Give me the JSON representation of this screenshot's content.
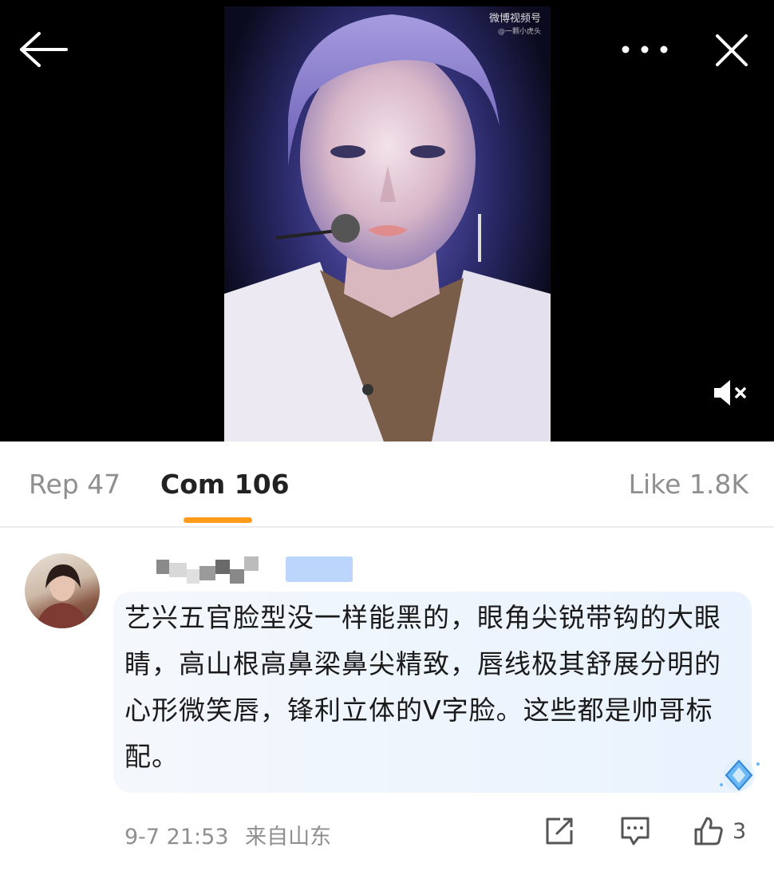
{
  "video": {
    "watermark_title": "微博视频号",
    "watermark_sub": "@一颗小虎头"
  },
  "top_bar": {
    "back_icon": "arrow-left-icon",
    "more_icon": "more-dots-icon",
    "close_icon": "close-icon",
    "mute_icon": "volume-muted-icon"
  },
  "tabs": [
    {
      "label": "Rep 47",
      "active": false
    },
    {
      "label": "Com 106",
      "active": true
    },
    {
      "label": "Like 1.8K",
      "active": false
    }
  ],
  "colors": {
    "accent": "#ff9c1b",
    "bubble": "#eef5fd",
    "username_blur_badge": "#bcd6fb"
  },
  "comment": {
    "text": "艺兴五官脸型没一样能黑的，眼角尖锐带钩的大眼睛，高山根高鼻梁鼻尖精致，唇线极其舒展分明的心形微笑唇，锋利立体的V字脸。这些都是帅哥标配。",
    "time": "9-7 21:53",
    "location": "来自山东",
    "like_count": "3",
    "share_icon": "share-edit-icon",
    "comment_icon": "comment-bubble-icon",
    "like_icon": "thumbs-up-icon"
  }
}
